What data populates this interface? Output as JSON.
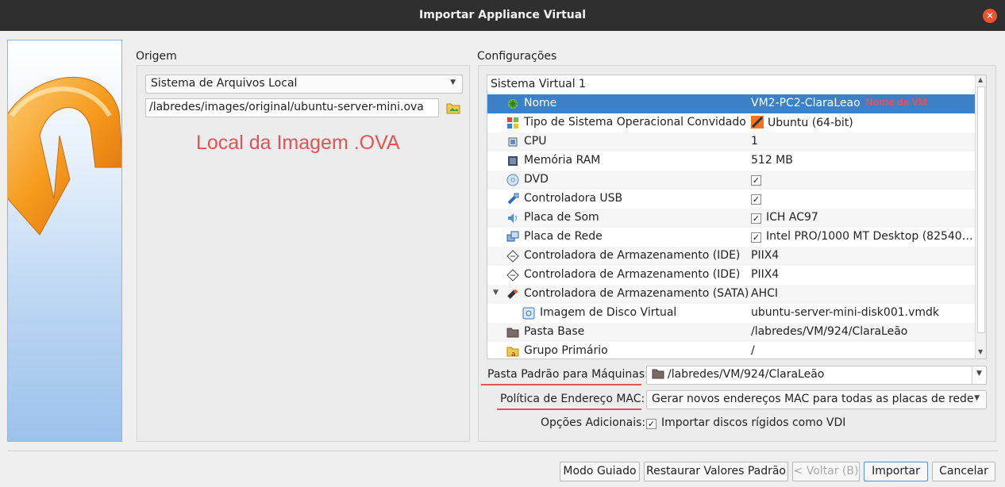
{
  "window": {
    "title": "Importar Appliance Virtual"
  },
  "source": {
    "group_title": "Origem",
    "source_type": "Sistema de Arquivos Local",
    "file_path": "/labredes/images/original/ubuntu-server-mini.ova",
    "annotation": "Local da Imagem .OVA"
  },
  "settings": {
    "group_title": "Configurações",
    "annotation_vm_name": "Nome da VM",
    "annotation_color": "#e05455",
    "selection_color": "#3c80c8",
    "system_label": "Sistema Virtual 1",
    "rows": [
      {
        "label": "Nome",
        "value": "VM2-PC2-ClaraLeao",
        "icon": "name-icon",
        "checked": false
      },
      {
        "label": "Tipo de Sistema Operacional Convidado",
        "value": "Ubuntu (64-bit)",
        "icon": "os-type-icon",
        "checked": false
      },
      {
        "label": "CPU",
        "value": "1",
        "icon": "cpu-icon",
        "checked": false
      },
      {
        "label": "Memória RAM",
        "value": "512 MB",
        "icon": "ram-icon",
        "checked": false
      },
      {
        "label": "DVD",
        "value": "",
        "icon": "dvd-icon",
        "checked": true
      },
      {
        "label": "Controladora USB",
        "value": "",
        "icon": "usb-icon",
        "checked": true
      },
      {
        "label": "Placa de Som",
        "value": "ICH AC97",
        "icon": "sound-icon",
        "checked": true
      },
      {
        "label": "Placa de Rede",
        "value": "Intel PRO/1000 MT Desktop (82540…",
        "icon": "network-icon",
        "checked": true
      },
      {
        "label": "Controladora de Armazenamento (IDE)",
        "value": "PIIX4",
        "icon": "ide-icon",
        "checked": false
      },
      {
        "label": "Controladora de Armazenamento (IDE)",
        "value": "PIIX4",
        "icon": "ide-icon",
        "checked": false
      },
      {
        "label": "Controladora de Armazenamento (SATA)",
        "value": "AHCI",
        "icon": "sata-icon",
        "checked": false
      },
      {
        "label": "Imagem de Disco Virtual",
        "value": "ubuntu-server-mini-disk001.vmdk",
        "icon": "disk-image-icon",
        "checked": false
      },
      {
        "label": "Pasta Base",
        "value": "/labredes/VM/924/ClaraLeão",
        "icon": "folder-icon",
        "checked": false
      },
      {
        "label": "Grupo Primário",
        "value": "/",
        "icon": "group-icon",
        "checked": false
      }
    ],
    "machine_folder_label": "Pasta Padrão para Máquinas:",
    "machine_folder_value": "/labredes/VM/924/ClaraLeão",
    "mac_policy_label": "Política de Endereço MAC:",
    "mac_policy_value": "Gerar novos endereços MAC para todas as placas de rede",
    "extra_options_label": "Opções Adicionais:",
    "import_vdi_label": "Importar discos rígidos como VDI",
    "import_vdi_checked": true
  },
  "buttons": {
    "guided": "Modo Guiado",
    "restore": "Restaurar Valores Padrão",
    "back": "< Voltar (B)",
    "import": "Importar",
    "cancel": "Cancelar"
  }
}
